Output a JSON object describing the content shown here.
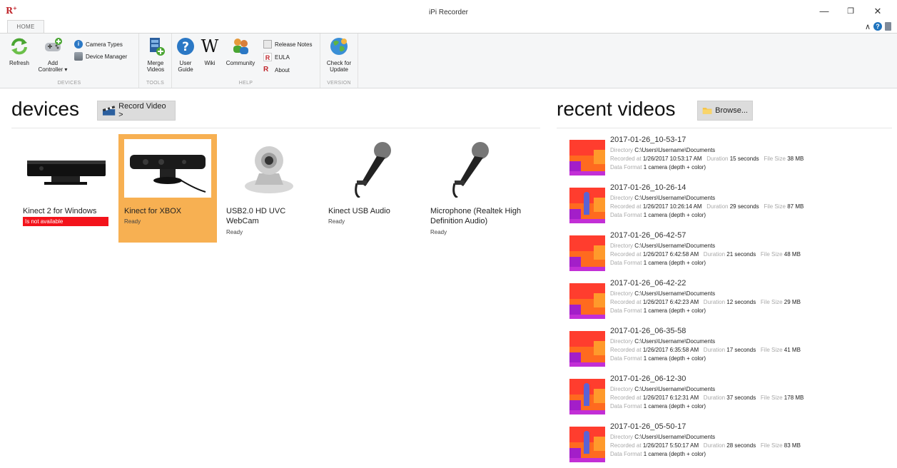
{
  "window": {
    "title": "iPi Recorder",
    "logo": "R",
    "logo_sup": "+",
    "controls": [
      "—",
      "❐",
      "✕"
    ]
  },
  "ribbon": {
    "tab": "HOME",
    "groups": {
      "devices": {
        "label": "DEVICES",
        "refresh": "Refresh",
        "add_controller_1": "Add",
        "add_controller_2": "Controller ▾",
        "camera_types": "Camera Types",
        "device_manager": "Device Manager"
      },
      "tools": {
        "label": "TOOLS",
        "merge_1": "Merge",
        "merge_2": "Videos"
      },
      "help": {
        "label": "HELP",
        "user_guide_1": "User",
        "user_guide_2": "Guide",
        "wiki": "Wiki",
        "community": "Community",
        "release_notes": "Release Notes",
        "eula": "EULA",
        "about": "About"
      },
      "version": {
        "label": "VERSION",
        "check_1": "Check for",
        "check_2": "Update"
      }
    }
  },
  "devices": {
    "heading": "devices",
    "record_button": "Record Video >",
    "items": [
      {
        "name": "Kinect 2 for Windows",
        "status": "Is not available",
        "state": "error"
      },
      {
        "name": "Kinect for XBOX",
        "status": "Ready",
        "state": "selected"
      },
      {
        "name": "USB2.0 HD UVC WebCam",
        "status": "Ready",
        "state": "ok"
      },
      {
        "name": "Kinect USB Audio",
        "status": "Ready",
        "state": "ok"
      },
      {
        "name": "Microphone (Realtek High Definition Audio)",
        "status": "Ready",
        "state": "ok"
      }
    ]
  },
  "recent": {
    "heading": "recent videos",
    "browse_button": "Browse...",
    "labels": {
      "directory": "Directory",
      "recorded": "Recorded at",
      "duration": "Duration",
      "filesize": "File Size",
      "format": "Data Format"
    },
    "videos": [
      {
        "title": "2017-01-26_10-53-17",
        "directory": "C:\\Users\\Username\\Documents",
        "recorded": "1/26/2017 10:53:17 AM",
        "duration": "15 seconds",
        "size": "38 MB",
        "format": "1 camera (depth + color)"
      },
      {
        "title": "2017-01-26_10-26-14",
        "directory": "C:\\Users\\Username\\Documents",
        "recorded": "1/26/2017 10:26:14 AM",
        "duration": "29 seconds",
        "size": "87 MB",
        "format": "1 camera (depth + color)"
      },
      {
        "title": "2017-01-26_06-42-57",
        "directory": "C:\\Users\\Username\\Documents",
        "recorded": "1/26/2017 6:42:58 AM",
        "duration": "21 seconds",
        "size": "48 MB",
        "format": "1 camera (depth + color)"
      },
      {
        "title": "2017-01-26_06-42-22",
        "directory": "C:\\Users\\Username\\Documents",
        "recorded": "1/26/2017 6:42:23 AM",
        "duration": "12 seconds",
        "size": "29 MB",
        "format": "1 camera (depth + color)"
      },
      {
        "title": "2017-01-26_06-35-58",
        "directory": "C:\\Users\\Username\\Documents",
        "recorded": "1/26/2017 6:35:58 AM",
        "duration": "17 seconds",
        "size": "41 MB",
        "format": "1 camera (depth + color)"
      },
      {
        "title": "2017-01-26_06-12-30",
        "directory": "C:\\Users\\Username\\Documents",
        "recorded": "1/26/2017 6:12:31 AM",
        "duration": "37 seconds",
        "size": "178 MB",
        "format": "1 camera (depth + color)"
      },
      {
        "title": "2017-01-26_05-50-17",
        "directory": "C:\\Users\\Username\\Documents",
        "recorded": "1/26/2017 5:50:17 AM",
        "duration": "28 seconds",
        "size": "83 MB",
        "format": "1 camera (depth + color)"
      }
    ]
  },
  "colors": {
    "selected": "#f7b052",
    "error": "#f3131b",
    "ribbon": "#f5f6f7"
  }
}
